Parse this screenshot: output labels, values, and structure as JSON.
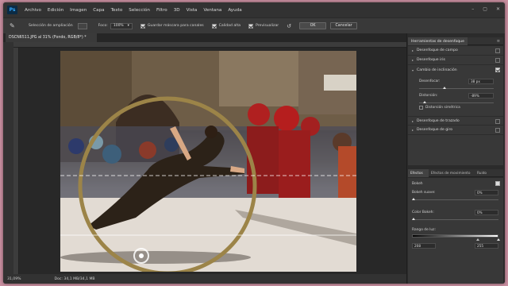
{
  "menu": {
    "logo": "Ps",
    "items": [
      "Archivo",
      "Edición",
      "Imagen",
      "Capa",
      "Texto",
      "Selección",
      "Filtro",
      "3D",
      "Vista",
      "Ventana",
      "Ayuda"
    ]
  },
  "options": {
    "selection_label": "Selección de ampliación",
    "focus_label": "Foco:",
    "focus_value": "100%",
    "save_mask_label": "Guardar máscara para canales",
    "quality_label": "Calidad alta",
    "preview_label": "Previsualizar",
    "ok_label": "OK",
    "cancel_label": "Cancelar"
  },
  "document": {
    "tab_title": "DSCN6511.JPG al 31% (Fondo, RGB/8*) *"
  },
  "status": {
    "zoom": "31,09%",
    "doc_info": "Doc: 34,1 MB/34,1 MB"
  },
  "blur_panel": {
    "title": "Herramientas de desenfoque",
    "items": [
      {
        "label": "Desenfoque de campo",
        "checked": false
      },
      {
        "label": "Desenfoque iris",
        "checked": false
      },
      {
        "label": "Cambio de inclinación",
        "checked": true
      },
      {
        "label": "Desenfoque de trazado",
        "checked": false
      },
      {
        "label": "Desenfoque de giro",
        "checked": false
      }
    ],
    "blur_label": "Desenfocar:",
    "blur_value": "38 px",
    "distortion_label": "Distorsión:",
    "distortion_value": "-89%",
    "symmetric_label": "Distorsión simétrica"
  },
  "effects_panel": {
    "tabs": [
      "Efectos",
      "Efectos de movimiento",
      "Ruido"
    ],
    "bokeh_label": "Bokeh",
    "light_bokeh_label": "Bokeh suave:",
    "light_bokeh_value": "0%",
    "color_bokeh_label": "Color Bokeh:",
    "color_bokeh_value": "0%",
    "light_range_label": "Rango de luz:",
    "light_range_min": "208",
    "light_range_max": "255"
  }
}
